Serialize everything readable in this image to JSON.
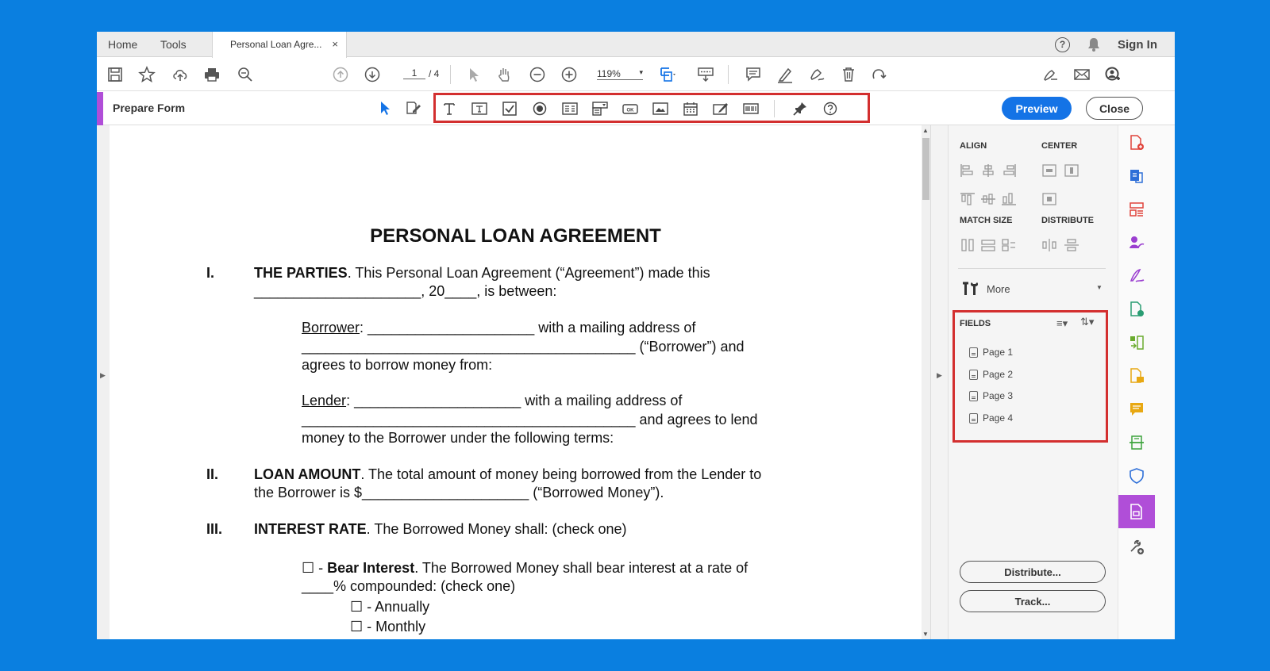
{
  "tabs": {
    "home": "Home",
    "tools": "Tools",
    "doc_tab": "Personal Loan Agre...",
    "close": "×"
  },
  "header": {
    "sign_in": "Sign In",
    "help": "?"
  },
  "toolbar": {
    "page_current": "1",
    "page_total": "/ 4",
    "zoom": "119%",
    "zoom_caret": "▾"
  },
  "form_bar": {
    "title": "Prepare Form",
    "preview": "Preview",
    "close": "Close",
    "ok_label": "OK"
  },
  "document": {
    "title": "PERSONAL LOAN AGREEMENT",
    "s1_num": "I.",
    "s1_head": "THE PARTIES",
    "s1_text": ". This Personal Loan Agreement (“Agreement”) made this",
    "s1_line2": "_____________________, 20____, is between:",
    "borrower_label": "Borrower",
    "borrower_text": ": _____________________ with a mailing address of",
    "borrower_line2": "__________________________________________ (“Borrower”) and",
    "borrower_line3": "agrees to borrow money from:",
    "lender_label": "Lender",
    "lender_text": ": _____________________ with a mailing address of",
    "lender_line2": "__________________________________________ and agrees to lend",
    "lender_line3": "money to the Borrower under the following terms:",
    "s2_num": "II.",
    "s2_head": "LOAN AMOUNT",
    "s2_text": ". The total amount of money being borrowed from the Lender to",
    "s2_line2": "the Borrower is $_____________________ (“Borrowed Money”).",
    "s3_num": "III.",
    "s3_head": "INTEREST RATE",
    "s3_text": ". The Borrowed Money shall: (check one)",
    "bear_box": "☐ - ",
    "bear_head": "Bear Interest",
    "bear_text": ". The Borrowed Money shall bear interest at a rate of",
    "bear_line2": "____% compounded: (check one)",
    "annually": "☐ - Annually",
    "monthly": "☐ - Monthly"
  },
  "panel": {
    "align": "ALIGN",
    "center": "CENTER",
    "match_size": "MATCH SIZE",
    "distribute": "DISTRIBUTE",
    "more": "More",
    "fields": "FIELDS",
    "pages": [
      "Page 1",
      "Page 2",
      "Page 3",
      "Page 4"
    ],
    "distribute_btn": "Distribute...",
    "track_btn": "Track..."
  },
  "colors": {
    "accent_purple": "#b04ed8",
    "preview_blue": "#1473e6",
    "highlight_red": "#d32f2f",
    "background_blue": "#0a7fe0"
  }
}
